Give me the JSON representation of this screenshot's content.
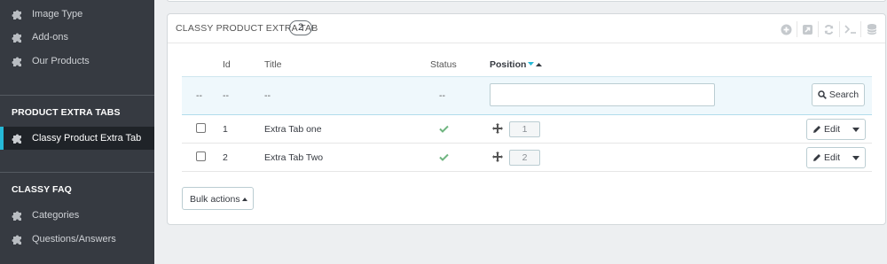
{
  "sidebar": {
    "top_items": [
      {
        "label": "Image Type",
        "icon": "puzzle-icon"
      },
      {
        "label": "Add-ons",
        "icon": "puzzle-icon"
      },
      {
        "label": "Our Products",
        "icon": "puzzle-icon"
      }
    ],
    "section1_title": "PRODUCT EXTRA TABS",
    "section1_items": [
      {
        "label": "Classy Product Extra Tab",
        "icon": "puzzle-icon",
        "active": true
      }
    ],
    "section2_title": "CLASSY FAQ",
    "section2_items": [
      {
        "label": "Categories",
        "icon": "puzzle-icon"
      },
      {
        "label": "Questions/Answers",
        "icon": "puzzle-icon"
      }
    ]
  },
  "panel": {
    "title": "CLASSY PRODUCT EXTRA TAB",
    "count": "2",
    "toolbar_icons": [
      "add-new-icon",
      "export-icon",
      "refresh-icon",
      "sql-query-icon",
      "database-icon"
    ]
  },
  "table": {
    "headers": {
      "id": "Id",
      "title": "Title",
      "status": "Status",
      "position": "Position"
    },
    "filter": {
      "placeholder_dash": "--",
      "search_label": "Search"
    },
    "rows": [
      {
        "id": "1",
        "title": "Extra Tab one",
        "status": "enabled",
        "position": "1",
        "edit_label": "Edit"
      },
      {
        "id": "2",
        "title": "Extra Tab Two",
        "status": "enabled",
        "position": "2",
        "edit_label": "Edit"
      }
    ]
  },
  "footer": {
    "bulk_actions_label": "Bulk actions"
  },
  "colors": {
    "sidebar_bg": "#363a41",
    "active_bar": "#25b9d7",
    "check_green": "#70b580",
    "filter_bg": "#eff8fc"
  }
}
